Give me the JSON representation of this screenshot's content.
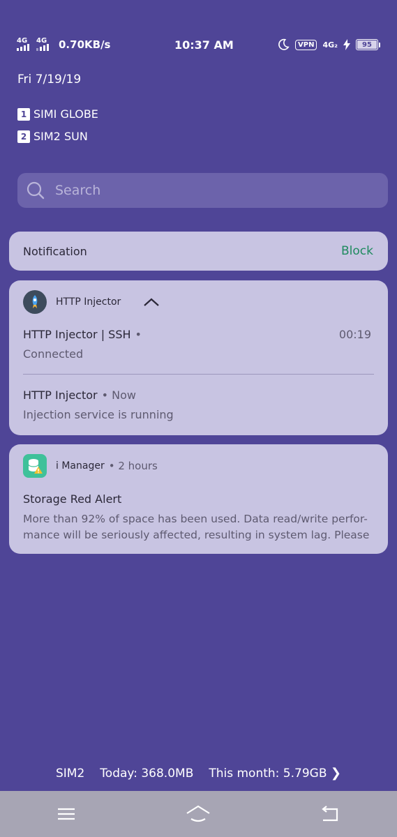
{
  "status_bar": {
    "sim1_network": "4G",
    "sim2_network": "4G",
    "speed": "0.70KB/s",
    "time": "10:37 AM",
    "vpn_label": "VPN",
    "data_network": "4G₂",
    "battery": "95"
  },
  "date": "Fri 7/19/19",
  "sims": [
    {
      "num": "1",
      "label": "SIMI GLOBE"
    },
    {
      "num": "2",
      "label": "SIM2 SUN"
    }
  ],
  "search": {
    "placeholder": "Search"
  },
  "notification_header": {
    "title": "Notification",
    "action": "Block"
  },
  "http_injector": {
    "app_name": "HTTP Injector",
    "items": [
      {
        "title": "HTTP Injector | SSH",
        "meta": "•",
        "text": "Connected",
        "time": "00:19"
      },
      {
        "title": "HTTP Injector",
        "meta": "• Now",
        "text": "Injection service is running"
      }
    ]
  },
  "imanager": {
    "app_name": "i Manager",
    "meta": "• 2 hours",
    "title": "Storage Red Alert",
    "body_line1": "More than 92% of space has been used. Data read/write perfor-",
    "body_line2": "mance will be seriously affected, resulting in system lag. Please fre…"
  },
  "data_usage": {
    "sim": "SIM2",
    "today": "Today: 368.0MB",
    "month": "This month: 5.79GB"
  },
  "colors": {
    "background": "#4f4597",
    "card": "#c8c4e2",
    "block_action": "#1e8a5e",
    "nav_bar": "#a7a5b4"
  }
}
